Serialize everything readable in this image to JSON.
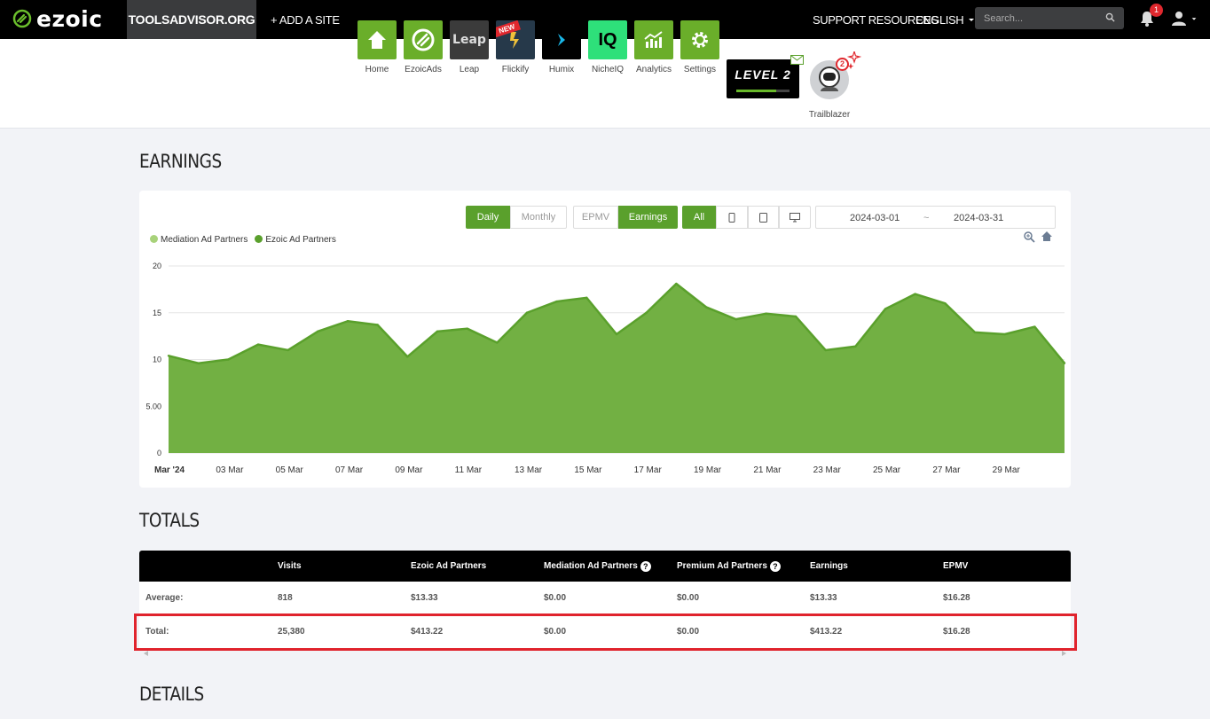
{
  "topnav": {
    "brand": "ezoic",
    "site": "TOOLSADVISOR.ORG",
    "add_site": "+ ADD A SITE",
    "support": "SUPPORT RESOURCES",
    "language": "ENGLISH",
    "search_placeholder": "Search...",
    "notifications_count": "1"
  },
  "apps": [
    {
      "label": "Home",
      "icon": "home-icon"
    },
    {
      "label": "EzoicAds",
      "icon": "ezoicads-icon"
    },
    {
      "label": "Leap",
      "icon": "leap-icon",
      "tile_text": "Leap"
    },
    {
      "label": "Flickify",
      "icon": "flickify-icon",
      "badge": "NEW"
    },
    {
      "label": "Humix",
      "icon": "humix-icon"
    },
    {
      "label": "NicheIQ",
      "icon": "nicheiq-icon",
      "tile_text": "IQ"
    },
    {
      "label": "Analytics",
      "icon": "analytics-icon"
    },
    {
      "label": "Settings",
      "icon": "gear-icon"
    }
  ],
  "level": {
    "text": "LEVEL 2",
    "progress": 0.75
  },
  "trailblazer": {
    "label": "Trailblazer",
    "badge": "2"
  },
  "earnings": {
    "title": "EARNINGS",
    "toggles": {
      "daily": "Daily",
      "monthly": "Monthly",
      "epmv": "EPMV",
      "earnings": "Earnings",
      "all": "All"
    },
    "date_from": "2024-03-01",
    "date_sep": "~",
    "date_to": "2024-03-31",
    "legend": [
      "Mediation Ad Partners",
      "Ezoic Ad Partners"
    ],
    "colors": {
      "mediation": "#a8d27a",
      "ezoic": "#5aa02c",
      "area": "#72b043"
    }
  },
  "chart_data": {
    "type": "area",
    "title": "",
    "xlabel": "",
    "ylabel": "",
    "ylim": [
      0,
      20
    ],
    "y_ticks": [
      "0",
      "5.00",
      "10",
      "15",
      "20"
    ],
    "x_tick_labels": [
      "Mar '24",
      "03 Mar",
      "05 Mar",
      "07 Mar",
      "09 Mar",
      "11 Mar",
      "13 Mar",
      "15 Mar",
      "17 Mar",
      "19 Mar",
      "21 Mar",
      "23 Mar",
      "25 Mar",
      "27 Mar",
      "29 Mar"
    ],
    "x": [
      "2024-03-01",
      "2024-03-02",
      "2024-03-03",
      "2024-03-04",
      "2024-03-05",
      "2024-03-06",
      "2024-03-07",
      "2024-03-08",
      "2024-03-09",
      "2024-03-10",
      "2024-03-11",
      "2024-03-12",
      "2024-03-13",
      "2024-03-14",
      "2024-03-15",
      "2024-03-16",
      "2024-03-17",
      "2024-03-18",
      "2024-03-19",
      "2024-03-20",
      "2024-03-21",
      "2024-03-22",
      "2024-03-23",
      "2024-03-24",
      "2024-03-25",
      "2024-03-26",
      "2024-03-27",
      "2024-03-28",
      "2024-03-29",
      "2024-03-30",
      "2024-03-31"
    ],
    "series": [
      {
        "name": "Mediation Ad Partners",
        "values": [
          0,
          0,
          0,
          0,
          0,
          0,
          0,
          0,
          0,
          0,
          0,
          0,
          0,
          0,
          0,
          0,
          0,
          0,
          0,
          0,
          0,
          0,
          0,
          0,
          0,
          0,
          0,
          0,
          0,
          0,
          0
        ]
      },
      {
        "name": "Ezoic Ad Partners",
        "values": [
          10.4,
          9.6,
          10.0,
          11.6,
          11.0,
          13.0,
          14.1,
          13.7,
          10.3,
          13.0,
          13.3,
          11.8,
          15.0,
          16.2,
          16.6,
          12.7,
          15.0,
          18.1,
          15.6,
          14.3,
          14.9,
          14.6,
          11.0,
          11.4,
          15.4,
          17.0,
          16.0,
          12.9,
          12.7,
          13.5,
          9.6
        ]
      }
    ],
    "grid": true,
    "legend_position": "top-left"
  },
  "totals": {
    "title": "TOTALS",
    "columns": [
      "",
      "Visits",
      "Ezoic Ad Partners",
      "Mediation Ad Partners",
      "Premium Ad Partners",
      "Earnings",
      "EPMV"
    ],
    "rows": [
      [
        "Average:",
        "818",
        "$13.33",
        "$0.00",
        "$0.00",
        "$13.33",
        "$16.28"
      ],
      [
        "Total:",
        "25,380",
        "$413.22",
        "$0.00",
        "$0.00",
        "$413.22",
        "$16.28"
      ]
    ]
  },
  "details": {
    "title": "DETAILS"
  }
}
